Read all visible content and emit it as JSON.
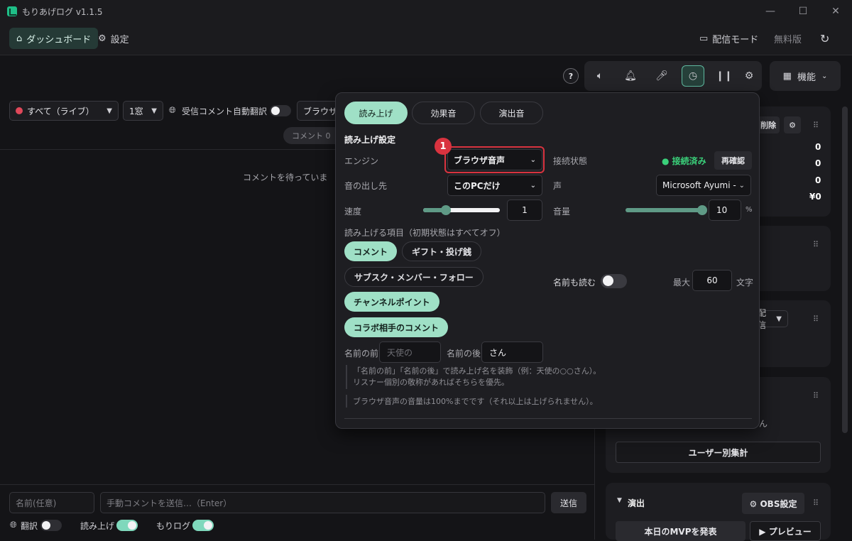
{
  "app": {
    "title": "もりあげログ v1.1.5"
  },
  "window": {
    "minimize": "—",
    "maximize": "☐",
    "close": "✕"
  },
  "nav": {
    "dashboard": "ダッシュボード",
    "settings": "設定",
    "stream_mode": "配信モード",
    "free_plan": "無料版"
  },
  "toolbar": {
    "help": "?",
    "features": "機能"
  },
  "left": {
    "filter": "すべて（ライブ）",
    "window_count": "1窓",
    "auto_translate": "受信コメント自動翻訳",
    "engine_select": "ブラウザ",
    "comment_count": "コメント 0",
    "waiting": "コメントを待っていま"
  },
  "bottom": {
    "name_placeholder": "名前(任意)",
    "comment_placeholder": "手動コメントを送信…（Enter）",
    "send": "送信",
    "translate": "翻訳",
    "read_aloud": "読み上げ",
    "morilog": "もりログ"
  },
  "right": {
    "delete": "削除",
    "stats": [
      "0",
      "0",
      "0",
      "¥0"
    ],
    "stream_sel": "配信",
    "suffix_text": "ん",
    "user_totals": "ユーザー別集計",
    "effects_title": "演出",
    "obs_settings": "⚙ OBS設定",
    "announce_mvp": "本日のMVPを発表",
    "preview": "▶ プレビュー"
  },
  "popup": {
    "tabs": [
      "読み上げ",
      "効果音",
      "演出音"
    ],
    "section_title": "読み上げ設定",
    "engine_label": "エンジン",
    "engine_value": "ブラウザ音声",
    "connection_label": "接続状態",
    "connected": "接続済み",
    "recheck": "再確認",
    "output_label": "音の出し先",
    "output_value": "このPCだけ",
    "voice_label": "声",
    "voice_value": "Microsoft Ayumi -",
    "speed_label": "速度",
    "speed_value": "1",
    "speed_level": 0.3,
    "volume_label": "音量",
    "volume_value": "10",
    "volume_unit": "%",
    "volume_level": 1.0,
    "items_label": "読み上げる項目（初期状態はすべてオフ）",
    "items": [
      {
        "label": "コメント",
        "on": true
      },
      {
        "label": "ギフト・投げ銭",
        "on": false
      },
      {
        "label": "サブスク・メンバー・フォロー",
        "on": false
      },
      {
        "label": "チャンネルポイント",
        "on": true
      },
      {
        "label": "コラボ相手のコメント",
        "on": true
      }
    ],
    "read_name_label": "名前も読む",
    "max_label": "最大",
    "max_value": "60",
    "max_unit": "文字",
    "prefix_label": "名前の前",
    "prefix_placeholder": "天使の",
    "suffix_label": "名前の後",
    "suffix_value": "さん",
    "note1": "「名前の前」「名前の後」で読み上げ名を装飾（例：天使の○○さん）。",
    "note2": "リスナー個別の敬称があればそちらを優先。",
    "note3": "ブラウザ音声の音量は100%までです（それ以上は上げられません）。",
    "marker": "1"
  },
  "colors": {
    "accent": "#9fe0c6",
    "connected": "#3ad07a",
    "highlight": "#d9333f"
  }
}
